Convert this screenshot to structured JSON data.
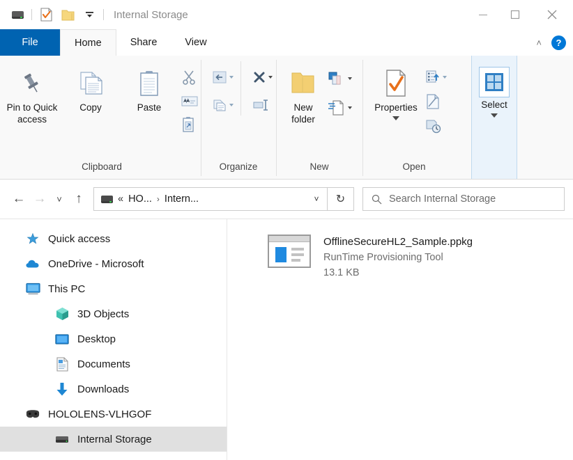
{
  "window": {
    "title": "Internal Storage",
    "minimize_label": "–",
    "maximize_label": "□",
    "close_label": "✕"
  },
  "quick_access_toolbar": {
    "items": [
      {
        "name": "drive-icon",
        "label": ""
      },
      {
        "name": "properties-icon",
        "label": ""
      },
      {
        "name": "new-folder-icon",
        "label": ""
      },
      {
        "name": "customize-dropdown-icon",
        "label": ""
      }
    ]
  },
  "ribbon": {
    "tabs": [
      {
        "label": "File",
        "state": "file"
      },
      {
        "label": "Home",
        "state": "active"
      },
      {
        "label": "Share",
        "state": "normal"
      },
      {
        "label": "View",
        "state": "normal"
      }
    ],
    "collapse_label": "˄",
    "help_label": "?",
    "groups": [
      {
        "label": "Clipboard",
        "big_buttons": [
          {
            "label": "Pin to Quick access",
            "icon": "pin-icon"
          },
          {
            "label": "Copy",
            "icon": "copy-icon"
          },
          {
            "label": "Paste",
            "icon": "paste-icon"
          }
        ],
        "small_buttons": [
          {
            "label": "Cut",
            "icon": "scissors-icon"
          },
          {
            "label": "Copy path",
            "icon": "copy-path-icon"
          },
          {
            "label": "Paste shortcut",
            "icon": "paste-shortcut-icon"
          }
        ]
      },
      {
        "label": "Organize",
        "small_buttons": [
          {
            "label": "Move to",
            "icon": "move-to-icon"
          },
          {
            "label": "Copy to",
            "icon": "copy-to-icon"
          },
          {
            "label": "Delete",
            "icon": "delete-x-icon"
          },
          {
            "label": "Rename",
            "icon": "rename-icon"
          }
        ]
      },
      {
        "label": "New",
        "big_buttons": [
          {
            "label": "New folder",
            "icon": "new-folder-icon"
          }
        ],
        "small_buttons": [
          {
            "label": "New item",
            "icon": "new-item-icon"
          },
          {
            "label": "Easy access",
            "icon": "easy-access-icon"
          }
        ]
      },
      {
        "label": "Open",
        "big_buttons": [
          {
            "label": "Properties",
            "icon": "properties-icon"
          }
        ],
        "small_buttons": [
          {
            "label": "Open",
            "icon": "open-icon"
          },
          {
            "label": "Edit",
            "icon": "edit-icon"
          },
          {
            "label": "History",
            "icon": "history-icon"
          }
        ]
      },
      {
        "label": "",
        "highlighted": true,
        "big_buttons": [
          {
            "label": "Select",
            "icon": "select-grid-icon"
          }
        ]
      }
    ]
  },
  "navigation": {
    "back_label": "←",
    "forward_label": "→",
    "recent_label": "˅",
    "up_label": "↑",
    "refresh_label": "↻",
    "breadcrumb": {
      "overflow_label": "«",
      "items": [
        {
          "label": "HO..."
        },
        {
          "label": "Intern..."
        }
      ],
      "separator": "›",
      "dropdown_label": "˅"
    }
  },
  "search": {
    "placeholder": "Search Internal Storage",
    "value": "",
    "icon": "search-icon"
  },
  "sidebar": {
    "items": [
      {
        "label": "Quick access",
        "icon": "star-icon",
        "indent": 0,
        "selected": false
      },
      {
        "label": "OneDrive - Microsoft",
        "icon": "cloud-icon",
        "indent": 0,
        "selected": false
      },
      {
        "label": "This PC",
        "icon": "monitor-icon",
        "indent": 0,
        "selected": false
      },
      {
        "label": "3D Objects",
        "icon": "cube-icon",
        "indent": 1,
        "selected": false
      },
      {
        "label": "Desktop",
        "icon": "desktop-icon",
        "indent": 1,
        "selected": false
      },
      {
        "label": "Documents",
        "icon": "documents-icon",
        "indent": 1,
        "selected": false
      },
      {
        "label": "Downloads",
        "icon": "download-arrow-icon",
        "indent": 1,
        "selected": false
      },
      {
        "label": "HOLOLENS-VLHGOF",
        "icon": "hololens-icon",
        "indent": 0,
        "selected": false
      },
      {
        "label": "Internal Storage",
        "icon": "drive-icon",
        "indent": 1,
        "selected": true
      }
    ]
  },
  "file_list": {
    "items": [
      {
        "name": "OfflineSecureHL2_Sample.ppkg",
        "type": "RunTime Provisioning Tool",
        "size": "13.1 KB",
        "icon": "provisioning-package-icon"
      }
    ]
  },
  "colors": {
    "accent": "#0078d7",
    "file_tab": "#0063b1",
    "selection": "#e0e0e0",
    "ribbon_bg": "#f9f9f9",
    "group_highlight": "#eaf3fb",
    "icon_blue": "#1f8ae0",
    "check_orange": "#e8701a"
  }
}
